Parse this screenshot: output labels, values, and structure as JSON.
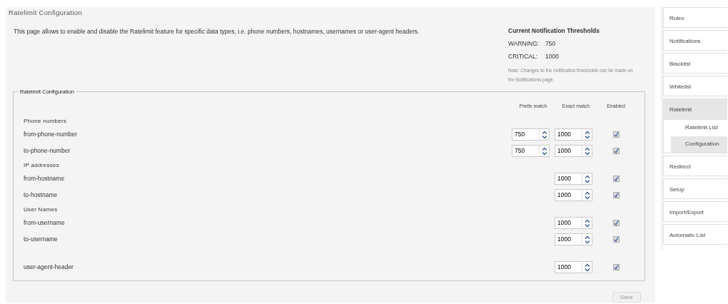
{
  "page": {
    "title": "Ratelimit Configuration",
    "description": "This page allows to enable and disable the Ratelimit feature for specific data types, i.e. phone numbers, hostnames, usernames or user-agent headers."
  },
  "thresholds": {
    "title": "Current Notification Thresholds",
    "levels": [
      {
        "label": "WARNING:",
        "value": "750"
      },
      {
        "label": "CRITICAL:",
        "value": "1000"
      }
    ],
    "note": "Note: Changes to the notification thresholds can be made on the Notifications page."
  },
  "config": {
    "legend": "Ratelimit Configuration",
    "columns": [
      "Prefix match",
      "Exact match",
      "Enabled"
    ],
    "groups": [
      {
        "heading": "Phone numbers",
        "rows": [
          {
            "name": "from-phone-number",
            "prefix": "750",
            "exact": "1000",
            "enabled": true
          },
          {
            "name": "to-phone-number",
            "prefix": "750",
            "exact": "1000",
            "enabled": true
          }
        ]
      },
      {
        "heading": "IP addresses",
        "rows": [
          {
            "name": "from-hostname",
            "exact": "1000",
            "enabled": true
          },
          {
            "name": "to-hostname",
            "exact": "1000",
            "enabled": true
          }
        ]
      },
      {
        "heading": "User Names",
        "rows": [
          {
            "name": "from-username",
            "exact": "1000",
            "enabled": true
          },
          {
            "name": "to-username",
            "exact": "1000",
            "enabled": true
          }
        ]
      },
      {
        "rows": [
          {
            "name": "user-agent-header",
            "exact": "1000",
            "enabled": true
          }
        ]
      }
    ]
  },
  "save_button": {
    "label": "Save",
    "disabled": true
  },
  "sidebar": {
    "items": [
      {
        "label": "Rules",
        "selected": false
      },
      {
        "label": "Notifications",
        "selected": false
      },
      {
        "label": "Blacklist",
        "selected": false
      },
      {
        "label": "Whitelist",
        "selected": false
      },
      {
        "label": "Ratelimit",
        "selected": true,
        "expanded": true,
        "children": [
          {
            "label": "Ratelimit List",
            "selected": false
          },
          {
            "label": "Configuration",
            "selected": true
          }
        ]
      },
      {
        "label": "Redirect",
        "selected": false
      },
      {
        "label": "Setup",
        "selected": false
      },
      {
        "label": "Import/Export",
        "selected": false
      },
      {
        "label": "Automatic List",
        "selected": false
      }
    ]
  }
}
